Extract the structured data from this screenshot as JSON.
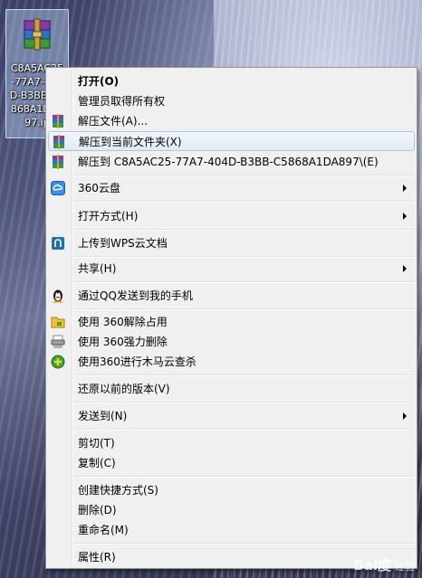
{
  "desktop": {
    "file_icon": "winrar-archive-icon",
    "file_name_label": "C8A5AC25-77A7-404D-B3BB-C5868A1DA897.ip"
  },
  "context_menu": {
    "items": [
      {
        "label": "打开(O)",
        "bold": true,
        "icon": null,
        "submenu": false
      },
      {
        "label": "管理员取得所有权",
        "icon": null,
        "submenu": false
      },
      {
        "label": "解压文件(A)...",
        "icon": "winrar-icon",
        "submenu": false
      },
      {
        "label": "解压到当前文件夹(X)",
        "icon": "winrar-icon",
        "submenu": false,
        "highlighted": true
      },
      {
        "label": "解压到 C8A5AC25-77A7-404D-B3BB-C5868A1DA897\\(E)",
        "icon": "winrar-icon",
        "submenu": false
      },
      {
        "label": "360云盘",
        "icon": "360-cloud-icon",
        "submenu": true
      },
      {
        "label": "打开方式(H)",
        "icon": null,
        "submenu": true
      },
      {
        "label": "上传到WPS云文档",
        "icon": "wps-cloud-icon",
        "submenu": false
      },
      {
        "label": "共享(H)",
        "icon": null,
        "submenu": true
      },
      {
        "label": "通过QQ发送到我的手机",
        "icon": "qq-penguin-icon",
        "submenu": false
      },
      {
        "label": "使用 360解除占用",
        "icon": "360-unlock-icon",
        "submenu": false
      },
      {
        "label": "使用 360强力删除",
        "icon": "360-shred-icon",
        "submenu": false
      },
      {
        "label": "使用360进行木马云查杀",
        "icon": "360-antivirus-icon",
        "submenu": false
      },
      {
        "label": "还原以前的版本(V)",
        "icon": null,
        "submenu": false
      },
      {
        "label": "发送到(N)",
        "icon": null,
        "submenu": true
      },
      {
        "label": "剪切(T)",
        "icon": null,
        "submenu": false
      },
      {
        "label": "复制(C)",
        "icon": null,
        "submenu": false
      },
      {
        "label": "创建快捷方式(S)",
        "icon": null,
        "submenu": false
      },
      {
        "label": "删除(D)",
        "icon": null,
        "submenu": false
      },
      {
        "label": "重命名(M)",
        "icon": null,
        "submenu": false
      },
      {
        "label": "属性(R)",
        "icon": null,
        "submenu": false
      }
    ]
  },
  "watermark": {
    "text": "Bai度",
    "sub": "经验"
  }
}
